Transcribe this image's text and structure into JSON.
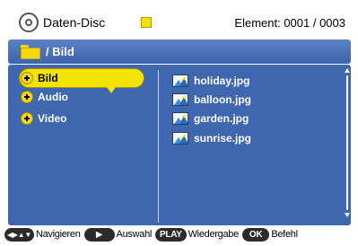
{
  "header": {
    "disc_label": "Daten-Disc",
    "element_label": "Element: 0001 / 0003"
  },
  "path": {
    "text": "/ Bild"
  },
  "tree": {
    "items": [
      {
        "label": "Bild",
        "selected": true
      },
      {
        "label": "Audio",
        "selected": false
      },
      {
        "label": "Video",
        "selected": false
      }
    ]
  },
  "files": {
    "items": [
      {
        "label": "holiday.jpg"
      },
      {
        "label": "balloon.jpg"
      },
      {
        "label": "garden.jpg"
      },
      {
        "label": "sunrise.jpg"
      }
    ]
  },
  "hints": {
    "navigate_key": "◀▶▲▼",
    "navigate_label": "Navigieren",
    "select_key": "▶",
    "select_label": "Auswahl",
    "play_key": "PLAY",
    "play_label": "Wiedergabe",
    "ok_key": "OK",
    "ok_label": "Befehl"
  },
  "colors": {
    "panel_blue": "#3e67b0",
    "highlight_yellow": "#f2e400"
  }
}
